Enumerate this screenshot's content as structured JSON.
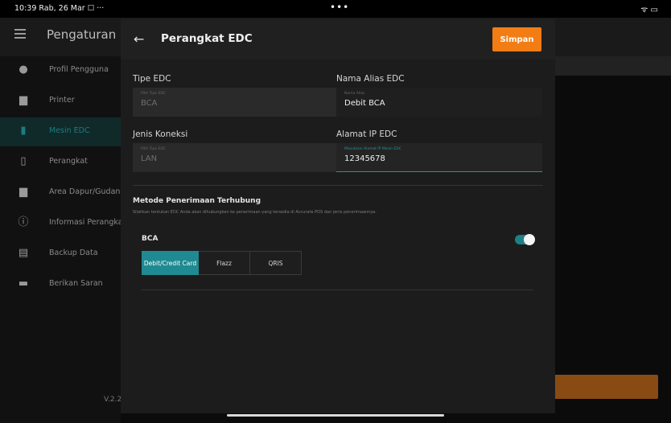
{
  "status_bar": {
    "time": "10:39  Rab, 26 Mar  ☐ ···",
    "center": "•••",
    "system": "ᯤ ▭"
  },
  "base": {
    "title": "Pengaturan",
    "version": "V.2.2",
    "sidebar": [
      {
        "label": "Profil Pengguna",
        "icon": "person-icon"
      },
      {
        "label": "Printer",
        "icon": "printer-icon"
      },
      {
        "label": "Mesin EDC",
        "icon": "edc-icon",
        "active": true
      },
      {
        "label": "Perangkat",
        "icon": "device-icon"
      },
      {
        "label": "Area Dapur/Gudang",
        "icon": "kitchen-printer-icon"
      },
      {
        "label": "Informasi Perangkat",
        "icon": "info-icon"
      },
      {
        "label": "Backup Data",
        "icon": "backup-icon"
      },
      {
        "label": "Berikan Saran",
        "icon": "feedback-icon"
      }
    ]
  },
  "modal": {
    "title": "Perangkat EDC",
    "save_label": "Simpan",
    "fields": {
      "tipe_edc": {
        "label": "Tipe EDC",
        "hint": "Pilih Tipe EDC",
        "value": "BCA"
      },
      "alias": {
        "label": "Nama Alias EDC",
        "hint": "Nama Alias",
        "value": "Debit BCA"
      },
      "koneksi": {
        "label": "Jenis Koneksi",
        "hint": "Pilih Tipe EDC",
        "value": "LAN"
      },
      "ip": {
        "label": "Alamat IP EDC",
        "hint": "Masukkan Alamat IP Mesin EDC",
        "value": "12345678"
      }
    },
    "section_title": "Metode Penerimaan Terhubung",
    "section_desc": "Silahkan tentukan EDC Anda akan dihubungkan ke penerimaan yang tersedia di Accurate POS dan jenis penerimaannya.",
    "bank": {
      "name": "BCA",
      "enabled": true
    },
    "methods": [
      "Debit/Credit Card",
      "Flazz",
      "QRIS"
    ],
    "selected_method": "Debit/Credit Card"
  },
  "colors": {
    "accent": "#f27d14",
    "teal": "#1f8a91"
  }
}
